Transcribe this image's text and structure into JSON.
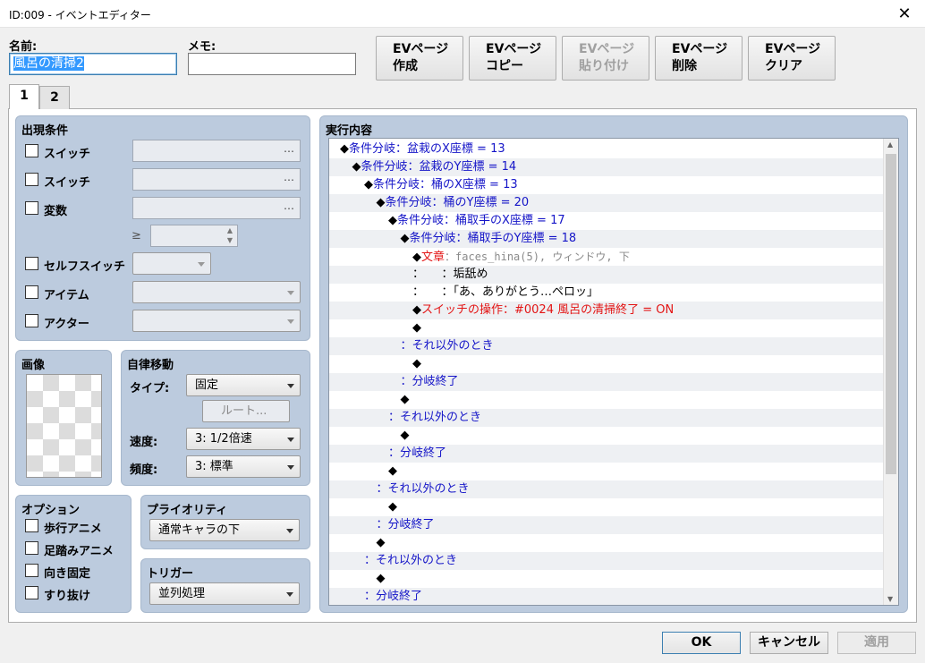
{
  "window": {
    "title": "ID:009 - イベントエディター",
    "close_symbol": "✕"
  },
  "name": {
    "label": "名前:",
    "value": "風呂の清掃2"
  },
  "memo": {
    "label": "メモ:",
    "value": ""
  },
  "top_buttons": [
    {
      "line1": "EVページ",
      "line2": "作成",
      "enabled": true
    },
    {
      "line1": "EVページ",
      "line2": "コピー",
      "enabled": true
    },
    {
      "line1": "EVページ",
      "line2": "貼り付け",
      "enabled": false
    },
    {
      "line1": "EVページ",
      "line2": "削除",
      "enabled": true
    },
    {
      "line1": "EVページ",
      "line2": "クリア",
      "enabled": true
    }
  ],
  "tabs": [
    {
      "label": "1",
      "active": true
    },
    {
      "label": "2",
      "active": false
    }
  ],
  "conditions": {
    "title": "出現条件",
    "switch1": "スイッチ",
    "switch2": "スイッチ",
    "variable": "変数",
    "gte": "≥",
    "self_switch": "セルフスイッチ",
    "item": "アイテム",
    "actor": "アクター",
    "ellipsis": "…"
  },
  "image": {
    "title": "画像"
  },
  "autonomous": {
    "title": "自律移動",
    "type_label": "タイプ:",
    "type_value": "固定",
    "route_button": "ルート...",
    "speed_label": "速度:",
    "speed_value": "3: 1/2倍速",
    "freq_label": "頻度:",
    "freq_value": "3: 標準"
  },
  "options": {
    "title": "オプション",
    "items": [
      "歩行アニメ",
      "足踏みアニメ",
      "向き固定",
      "すり抜け"
    ]
  },
  "priority": {
    "title": "プライオリティ",
    "value": "通常キャラの下"
  },
  "trigger": {
    "title": "トリガー",
    "value": "並列処理"
  },
  "contents": {
    "title": "実行内容",
    "lines": [
      {
        "indent": 0,
        "parts": [
          {
            "t": "◆",
            "c": "black"
          },
          {
            "t": "条件分岐：盆栽のX座標 = 13",
            "c": "blue"
          }
        ]
      },
      {
        "indent": 1,
        "parts": [
          {
            "t": "◆",
            "c": "black"
          },
          {
            "t": "条件分岐：盆栽のY座標 = 14",
            "c": "blue"
          }
        ]
      },
      {
        "indent": 2,
        "parts": [
          {
            "t": "◆",
            "c": "black"
          },
          {
            "t": "条件分岐：桶のX座標 = 13",
            "c": "blue"
          }
        ]
      },
      {
        "indent": 3,
        "parts": [
          {
            "t": "◆",
            "c": "black"
          },
          {
            "t": "条件分岐：桶のY座標 = 20",
            "c": "blue"
          }
        ]
      },
      {
        "indent": 4,
        "parts": [
          {
            "t": "◆",
            "c": "black"
          },
          {
            "t": "条件分岐：桶取手のX座標 = 17",
            "c": "blue"
          }
        ]
      },
      {
        "indent": 5,
        "parts": [
          {
            "t": "◆",
            "c": "black"
          },
          {
            "t": "条件分岐：桶取手のY座標 = 18",
            "c": "blue"
          }
        ]
      },
      {
        "indent": 6,
        "parts": [
          {
            "t": "◆",
            "c": "black"
          },
          {
            "t": "文章",
            "c": "red"
          },
          {
            "t": "：faces_hina(5), ウィンドウ, 下",
            "c": "gray"
          }
        ]
      },
      {
        "indent": 6,
        "parts": [
          {
            "t": "：　　：垢舐め",
            "c": "black"
          }
        ]
      },
      {
        "indent": 6,
        "parts": [
          {
            "t": "：　　：「あ、ありがとう…ペロッ」",
            "c": "black"
          }
        ]
      },
      {
        "indent": 6,
        "parts": [
          {
            "t": "◆",
            "c": "black"
          },
          {
            "t": "スイッチの操作：#0024 風呂の清掃終了 = ON",
            "c": "red"
          }
        ]
      },
      {
        "indent": 6,
        "parts": [
          {
            "t": "◆",
            "c": "black"
          }
        ]
      },
      {
        "indent": 5,
        "parts": [
          {
            "t": "：それ以外のとき",
            "c": "blue"
          }
        ]
      },
      {
        "indent": 6,
        "parts": [
          {
            "t": "◆",
            "c": "black"
          }
        ]
      },
      {
        "indent": 5,
        "parts": [
          {
            "t": "：分岐終了",
            "c": "blue"
          }
        ]
      },
      {
        "indent": 5,
        "parts": [
          {
            "t": "◆",
            "c": "black"
          }
        ]
      },
      {
        "indent": 4,
        "parts": [
          {
            "t": "：それ以外のとき",
            "c": "blue"
          }
        ]
      },
      {
        "indent": 5,
        "parts": [
          {
            "t": "◆",
            "c": "black"
          }
        ]
      },
      {
        "indent": 4,
        "parts": [
          {
            "t": "：分岐終了",
            "c": "blue"
          }
        ]
      },
      {
        "indent": 4,
        "parts": [
          {
            "t": "◆",
            "c": "black"
          }
        ]
      },
      {
        "indent": 3,
        "parts": [
          {
            "t": "：それ以外のとき",
            "c": "blue"
          }
        ]
      },
      {
        "indent": 4,
        "parts": [
          {
            "t": "◆",
            "c": "black"
          }
        ]
      },
      {
        "indent": 3,
        "parts": [
          {
            "t": "：分岐終了",
            "c": "blue"
          }
        ]
      },
      {
        "indent": 3,
        "parts": [
          {
            "t": "◆",
            "c": "black"
          }
        ]
      },
      {
        "indent": 2,
        "parts": [
          {
            "t": "：それ以外のとき",
            "c": "blue"
          }
        ]
      },
      {
        "indent": 3,
        "parts": [
          {
            "t": "◆",
            "c": "black"
          }
        ]
      },
      {
        "indent": 2,
        "parts": [
          {
            "t": "：分岐終了",
            "c": "blue"
          }
        ]
      }
    ]
  },
  "bottom_buttons": {
    "ok": "OK",
    "cancel": "キャンセル",
    "apply": "適用"
  },
  "colors": {
    "group_bg": "#bccbde",
    "blue_text": "#1515c8",
    "red_text": "#e31515"
  }
}
